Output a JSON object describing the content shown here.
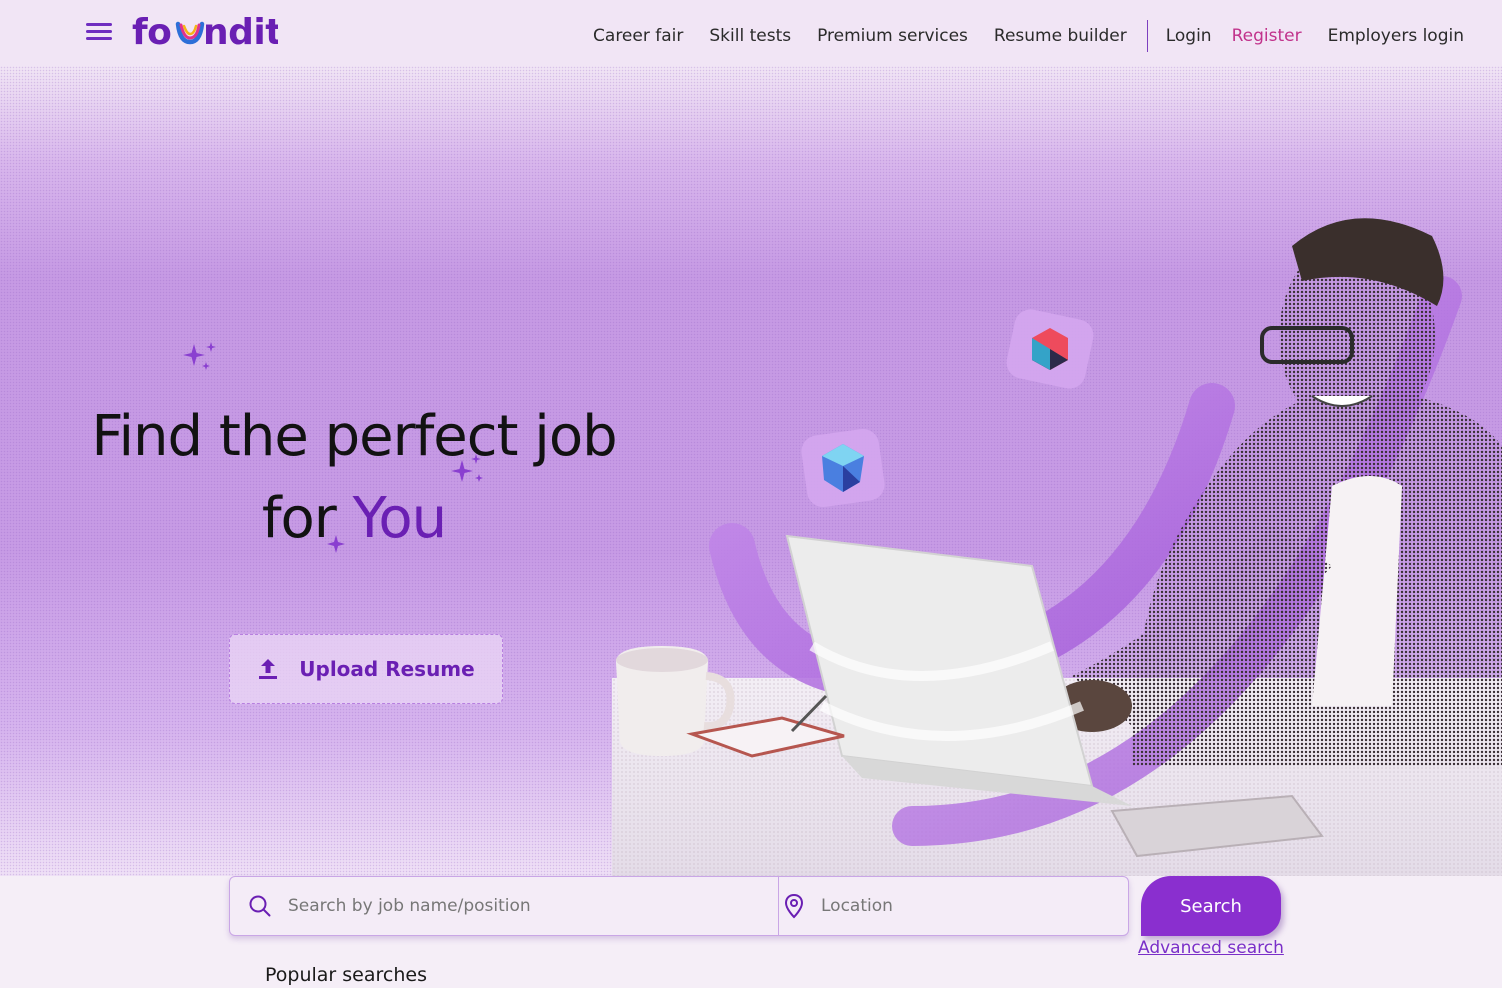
{
  "brand": {
    "logo_text": "foundit"
  },
  "nav": {
    "career_fair": "Career fair",
    "skill_tests": "Skill tests",
    "premium_services": "Premium services",
    "resume_builder": "Resume builder",
    "login": "Login",
    "register": "Register",
    "employers_login": "Employers login"
  },
  "hero": {
    "headline_line1": "Find the perfect job",
    "headline_for": "for ",
    "headline_you": "You",
    "upload_label": "Upload Resume"
  },
  "search": {
    "job_placeholder": "Search by job name/position",
    "location_placeholder": "Location",
    "button_label": "Search",
    "advanced_label": "Advanced search",
    "popular_label": "Popular searches"
  },
  "icons": {
    "menu": "hamburger-menu-icon",
    "upload": "upload-icon",
    "search": "search-icon",
    "location": "location-pin-icon",
    "sparkle": "sparkle-icon"
  },
  "colors": {
    "brand_purple": "#6a1fb3",
    "accent_pink": "#c1328b",
    "button_purple": "#8a2fcf"
  }
}
